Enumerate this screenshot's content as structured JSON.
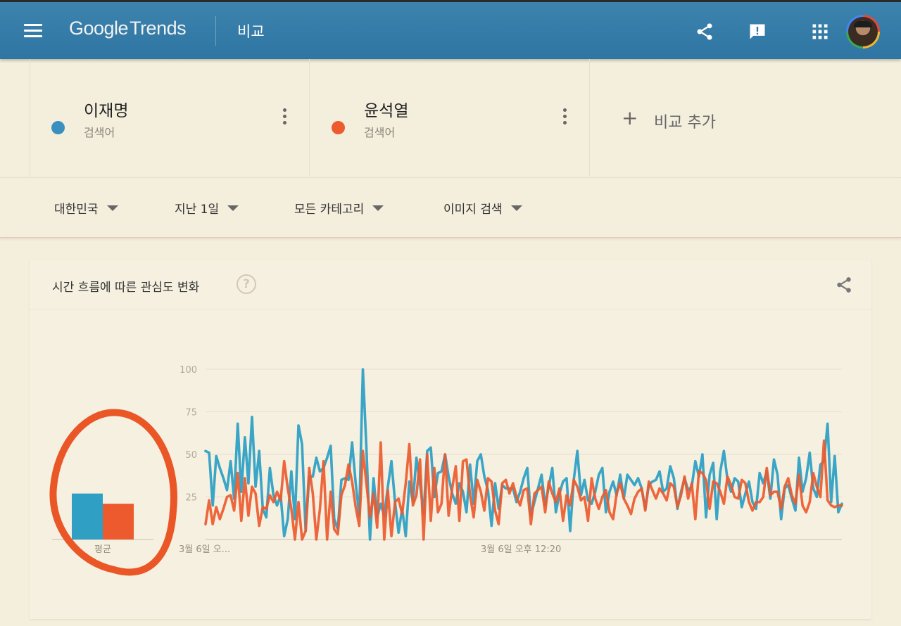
{
  "header": {
    "logo_google": "Google",
    "logo_trends": "Trends",
    "page_title": "비교",
    "icons": [
      "menu-icon",
      "share-icon",
      "feedback-icon",
      "apps-grid-icon",
      "avatar"
    ]
  },
  "terms": [
    {
      "name": "이재명",
      "type": "검색어",
      "color": "#3b8fbf"
    },
    {
      "name": "윤석열",
      "type": "검색어",
      "color": "#ec5a2e"
    }
  ],
  "add_compare": {
    "plus": "+",
    "label": "비교 추가"
  },
  "filters": [
    {
      "label": "대한민국"
    },
    {
      "label": "지난 1일"
    },
    {
      "label": "모든 카테고리"
    },
    {
      "label": "이미지 검색"
    }
  ],
  "card": {
    "title": "시간 흐름에 따른 관심도 변화",
    "help": "?"
  },
  "chart_data": {
    "type": "line",
    "y_ticks": [
      "100",
      "75",
      "50",
      "25"
    ],
    "ylim": [
      0,
      100
    ],
    "x_tick_labels": [
      "3월 6일 오...",
      "3월 6일 오후 12:20"
    ],
    "average_label": "평균",
    "averages": [
      {
        "series": "이재명",
        "value": 27
      },
      {
        "series": "윤석열",
        "value": 21
      }
    ],
    "series": [
      {
        "name": "이재명",
        "color": "#2fa0c4",
        "values": [
          52,
          51,
          20,
          49,
          42,
          36,
          29,
          46,
          24,
          68,
          28,
          60,
          33,
          72,
          31,
          52,
          18,
          13,
          42,
          26,
          20,
          26,
          2,
          12,
          40,
          12,
          67,
          56,
          5,
          37,
          37,
          48,
          40,
          42,
          48,
          55,
          12,
          6,
          35,
          36,
          35,
          57,
          33,
          14,
          100,
          54,
          0,
          36,
          13,
          21,
          14,
          31,
          46,
          22,
          4,
          18,
          2,
          34,
          22,
          48,
          33,
          15,
          52,
          54,
          25,
          39,
          40,
          50,
          37,
          27,
          21,
          33,
          28,
          16,
          44,
          21,
          46,
          50,
          37,
          29,
          8,
          33,
          18,
          32,
          30,
          30,
          30,
          22,
          28,
          36,
          42,
          14,
          22,
          30,
          38,
          20,
          31,
          42,
          16,
          27,
          34,
          36,
          5,
          35,
          52,
          26,
          35,
          23,
          21,
          28,
          38,
          42,
          16,
          28,
          34,
          26,
          38,
          24,
          38,
          35,
          32,
          36,
          30,
          18,
          32,
          34,
          35,
          40,
          28,
          30,
          43,
          36,
          18,
          28,
          36,
          29,
          31,
          46,
          37,
          50,
          13,
          38,
          45,
          12,
          40,
          52,
          35,
          28,
          36,
          34,
          19,
          27,
          34,
          22,
          18,
          39,
          33,
          40,
          24,
          47,
          38,
          12,
          30,
          32,
          24,
          17,
          48,
          28,
          36,
          51,
          30,
          25,
          44,
          46,
          68,
          22,
          49,
          16,
          21
        ]
      },
      {
        "name": "윤석열",
        "color": "#ec5a2e",
        "values": [
          9,
          23,
          9,
          19,
          12,
          18,
          25,
          26,
          17,
          39,
          11,
          36,
          14,
          31,
          27,
          8,
          19,
          18,
          26,
          22,
          28,
          23,
          46,
          30,
          18,
          0,
          22,
          0,
          5,
          42,
          27,
          0,
          18,
          46,
          0,
          28,
          6,
          3,
          26,
          32,
          44,
          34,
          19,
          8,
          52,
          33,
          13,
          27,
          7,
          57,
          0,
          29,
          2,
          22,
          24,
          15,
          33,
          56,
          20,
          26,
          47,
          0,
          50,
          11,
          42,
          16,
          21,
          50,
          14,
          30,
          43,
          11,
          46,
          47,
          26,
          13,
          35,
          28,
          17,
          36,
          34,
          17,
          9,
          33,
          35,
          27,
          33,
          25,
          20,
          29,
          30,
          9,
          27,
          29,
          31,
          16,
          34,
          27,
          22,
          30,
          11,
          26,
          20,
          35,
          31,
          23,
          25,
          11,
          36,
          24,
          18,
          25,
          29,
          16,
          12,
          27,
          33,
          24,
          20,
          15,
          24,
          28,
          30,
          17,
          34,
          29,
          24,
          30,
          27,
          23,
          33,
          31,
          19,
          26,
          37,
          24,
          33,
          12,
          40,
          39,
          35,
          18,
          34,
          33,
          28,
          21,
          37,
          32,
          25,
          24,
          35,
          33,
          22,
          17,
          22,
          22,
          25,
          42,
          26,
          28,
          28,
          18,
          31,
          36,
          26,
          21,
          38,
          20,
          16,
          22,
          39,
          31,
          25,
          58,
          23,
          20,
          19,
          20,
          20
        ]
      }
    ]
  }
}
